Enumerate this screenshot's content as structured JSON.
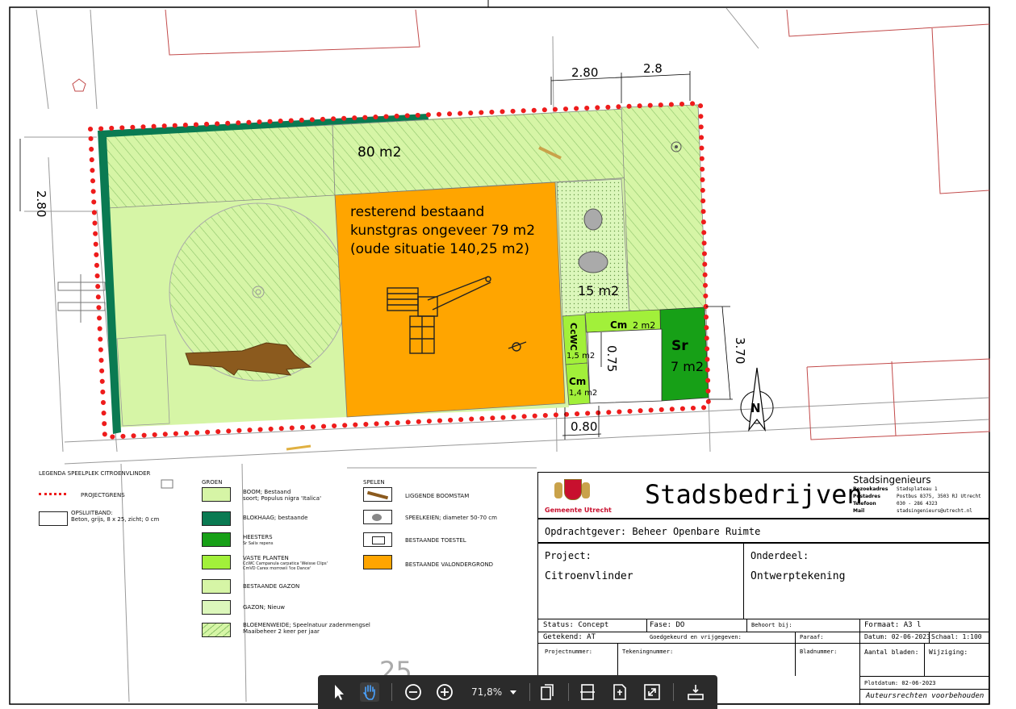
{
  "plan": {
    "dims": {
      "top_left": "2.80",
      "top_right": "2.8",
      "left": "2.80",
      "right": "3.70",
      "bottom": "0.80",
      "inner": "0.75"
    },
    "areas": {
      "meadow": "80 m2",
      "turf_line1": "resterend bestaand",
      "turf_line2": "kunstgras ongeveer 79 m2",
      "turf_line3": "(oude situatie 140,25 m2)",
      "lawn": "15 m2",
      "ccwc": "CcWC",
      "ccwc_area": "1,5 m2",
      "cm_top": "Cm",
      "cm_top_area": "2 m2",
      "cm_bottom": "Cm",
      "cm_bottom_area": "1,4 m2",
      "sr": "Sr",
      "sr_area": "7 m2"
    },
    "north": "N",
    "street_number": "25"
  },
  "legend": {
    "title": "LEGENDA SPEELPLEK CITROENVLINDER",
    "projectgrens": "PROJECTGRENS",
    "opsluitband": "OPSLUITBAND:",
    "opsluitband_sub": "Beton, grijs, 8 x 25, zicht; 0 cm",
    "groen_header": "GROEN",
    "spelen_header": "SPELEN",
    "boom": "BOOM; Bestaand",
    "boom_sub": "soort; Populus nigra 'Italica'",
    "blokhaag": "BLOKHAAG; bestaande",
    "heesters": "HEESTERS",
    "heesters_sub": "Sr       Salix repens",
    "vaste": "VASTE PLANTEN",
    "vaste_sub1": "CcWC    Campanula carpatica 'Weisse Clips'",
    "vaste_sub2": "CmVD    Carex morrowii 'Ice Dance'",
    "gazon": "BESTAANDE GAZON",
    "gazon_nieuw": "GAZON; Nieuw",
    "bloemen": "BLOEMENWEIDE; Speelnatuur zadenmengsel",
    "bloemen_sub": "Maaibeheer 2 keer per jaar",
    "boomstam": "LIGGENDE BOOMSTAM",
    "keien": "SPEELKEIEN; diameter 50-70 cm",
    "toestel": "BESTAANDE TOESTEL",
    "valondergrond": "BESTAANDE VALONDERGROND"
  },
  "titleblock": {
    "company": "Stadsbedrijven",
    "logo_text": "Gemeente Utrecht",
    "dept": "Stadsingenieurs",
    "bezoekadres_label": "Bezoekadres",
    "bezoekadres": "Stadsplateau 1",
    "postadres_label": "Postadres",
    "postadres": "Postbus 8375, 3503 RJ Utrecht",
    "telefoon_label": "Telefoon",
    "telefoon": "030 - 286 4323",
    "mail_label": "Mail",
    "mail": "stadsingenieurs@utrecht.nl",
    "opdrachtgever": "Opdrachtgever: Beheer Openbare Ruimte",
    "project_label": "Project:",
    "project": "Citroenvlinder",
    "onderdeel_label": "Onderdeel:",
    "onderdeel": "Ontwerptekening",
    "status": "Status: Concept",
    "fase": "Fase:  DO",
    "behoort": "Behoort bij:",
    "formaat": "Formaat: A3 l",
    "getekend": "Getekend:  AT",
    "goedgekeurd": "Goedgekeurd en vrijgegeven:",
    "paraaf": "Paraaf:",
    "datum": "Datum: 02-06-2023",
    "schaal": "Schaal: 1:100",
    "projectnummer": "Projectnummer:",
    "tekeningnummer": "Tekeningnummer:",
    "bladnummer": "Bladnummer:",
    "aantal": "Aantal bladen:",
    "wijziging": "Wijziging:",
    "plotdatum": "Plotdatum:  02-06-2023",
    "rechten": "Auteursrechten voorbehouden"
  },
  "toolbar": {
    "zoom": "71,8%"
  },
  "colors": {
    "boundary": "#ee1c1c",
    "hedge": "#0a7a52",
    "lawn": "#d6f5a6",
    "turf": "#ffa500",
    "perennial": "#a2f03a",
    "shrub": "#17a017"
  }
}
